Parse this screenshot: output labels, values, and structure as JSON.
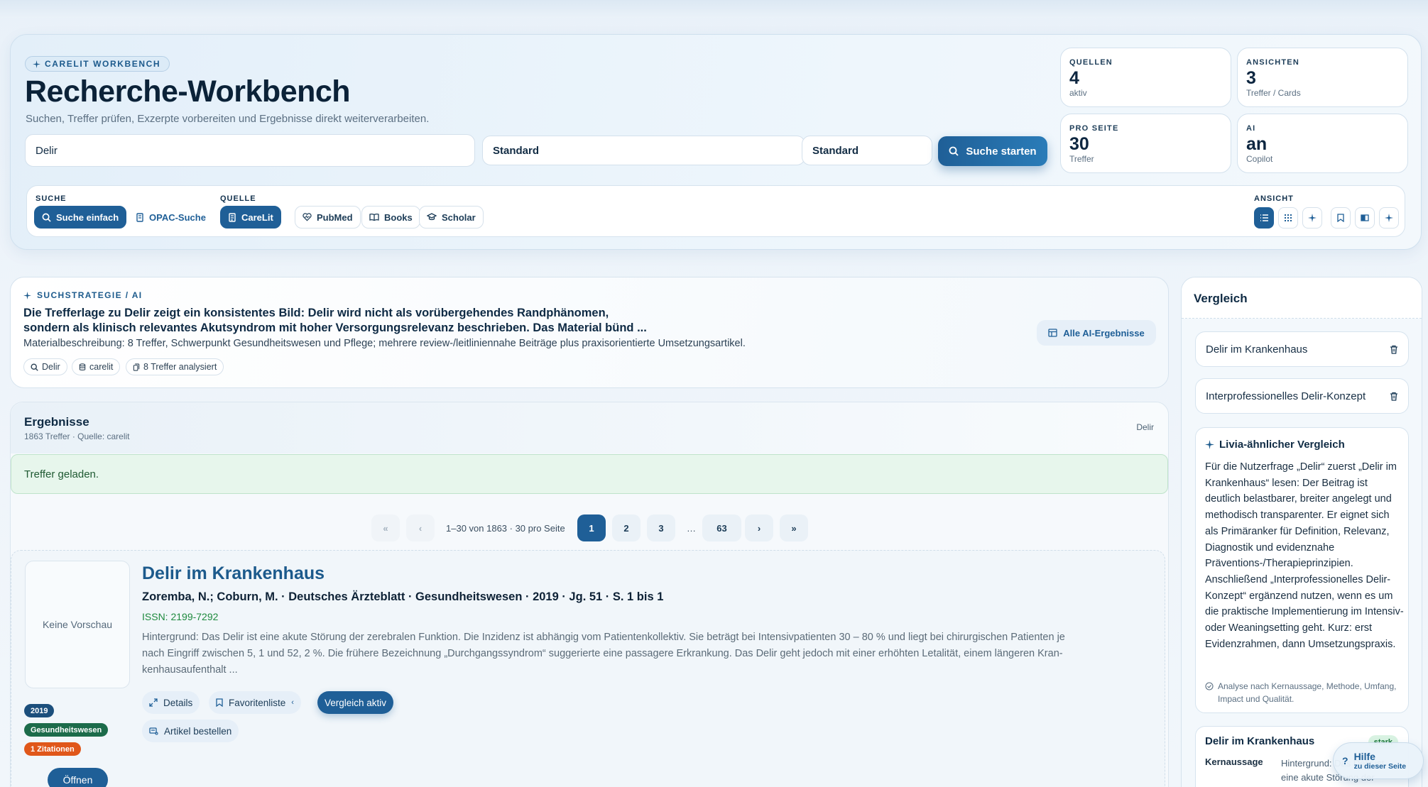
{
  "header": {
    "badge": "CARELIT WORKBENCH",
    "title": "Recherche-Workbench",
    "subtitle": "Suchen, Treffer prüfen, Exzerpte vorbereiten und Ergebnisse direkt weiterverarbeiten.",
    "search_value": "Delir",
    "select1": "Standard",
    "select2": "Standard",
    "search_button": "Suche starten"
  },
  "stats": [
    {
      "key": "QUELLEN",
      "value": "4",
      "sub": "aktiv"
    },
    {
      "key": "ANSICHTEN",
      "value": "3",
      "sub": "Treffer / Cards"
    },
    {
      "key": "PRO SEITE",
      "value": "30",
      "sub": "Treffer"
    },
    {
      "key": "AI",
      "value": "an",
      "sub": "Copilot"
    }
  ],
  "toolbar": {
    "suche_label": "SUCHE",
    "quelle_label": "QUELLE",
    "ansicht_label": "ANSICHT",
    "suche_einfach": "Suche einfach",
    "opac": "OPAC-Suche",
    "carelit": "CareLit",
    "pubmed": "PubMed",
    "books": "Books",
    "scholar": "Scholar"
  },
  "ai": {
    "kicker": "SUCHSTRATEGIE / AI",
    "title_line1": "Die Trefferlage zu Delir zeigt ein konsistentes Bild: Delir wird nicht als vorübergehendes Randphänomen,",
    "title_line2": "sondern als klinisch relevantes Akutsyndrom mit hoher Versorgungsrelevanz beschrieben. Das Material bünd ...",
    "description": "Materialbeschreibung: 8 Treffer, Schwerpunkt Gesundheitswesen und Pflege; mehrere review-/leitliniennahe Beiträge plus praxisorientierte Umsetzungsartikel.",
    "chip1": "Delir",
    "chip2": "carelit",
    "chip3": "8 Treffer analysiert",
    "button": "Alle AI-Ergebnisse"
  },
  "results": {
    "title": "Ergebnisse",
    "subtitle": "1863 Treffer · Quelle: carelit",
    "right": "Delir",
    "alert": "Treffer geladen.",
    "pager_info": "1–30 von 1863 · 30 pro Seite",
    "pages": [
      "1",
      "2",
      "3",
      "63"
    ],
    "first": "«",
    "prev": "‹",
    "next": "›",
    "last": "»",
    "ellipsis": "…"
  },
  "item": {
    "preview": "Keine Vorschau",
    "title": "Delir im Krankenhaus",
    "meta": "Zoremba, N.; Coburn, M. · Deutsches Ärzteblatt · Gesundheitswesen · 2019 · Jg. 51 · S. 1 bis 1",
    "issn": "ISSN: 2199-7292",
    "abstract_line1": "Hintergrund: Das Delir ist eine akute Störung der zerebralen Funktion. Die Inzidenz ist abhängig vom Patientenkollektiv. Sie beträgt bei Intensivpatienten 30 – 80 % und liegt bei chirurgischen Patienten je",
    "abstract_line2": "nach Eingriff zwischen 5, 1  und 52, 2 %. Die frühere Bezeichnung „Durchgangssyndrom“ suggerierte eine passagere Erkrankung. Das Delir geht jedoch mit einer erhöhten Letalität, einem längeren Kran-",
    "abstract_line3": "kenhausaufenthalt ...",
    "details": "Details",
    "favorites": "Favoritenliste",
    "compare": "Vergleich aktiv",
    "order": "Artikel bestellen",
    "tag_year": "2019",
    "tag_field": "Gesundheitswesen",
    "tag_cites": "1 Zitationen",
    "open": "Öffnen"
  },
  "sidebar": {
    "title": "Vergleich",
    "compare_items": [
      "Delir im Krankenhaus",
      "Interprofessionelles Delir-Konzept"
    ],
    "livia_title": "Livia-ähnlicher Vergleich",
    "livia_body": "Für die Nutzerfrage „Delir“ zuerst „Delir im Krankenhaus“ lesen: Der Beitrag ist deutlich belastbarer, breiter angelegt und methodisch transparenter. Er eignet sich als Primäranker für Definition, Relevanz, Diagnostik und evidenznahe Präventions-/Therapieprinzipien. Anschließend „Interprofessionelles Delir-Konzept“ ergänzend nutzen, wenn es um die praktische Implementierung im Intensiv- oder Weaningsetting geht. Kurz: erst Evidenzrahmen, dann Umsetzungspraxis.",
    "livia_note": "Analyse nach Kernaussage, Methode, Umfang, Impact und Qualität.",
    "card_title": "Delir im Krankenhaus",
    "card_badge": "stark",
    "card_key": "Kernaussage",
    "card_value": "Hintergrund: Das Delir ist eine akute Störung der zerebralen Funktion."
  },
  "help": {
    "line1": "Hilfe",
    "line2": "zu dieser Seite"
  },
  "colors": {
    "accent": "#1f5f97",
    "success": "#1e8a3e",
    "tag_year": "#1c4f7c",
    "tag_field": "#1c6b4a",
    "tag_cites": "#e0571a"
  }
}
